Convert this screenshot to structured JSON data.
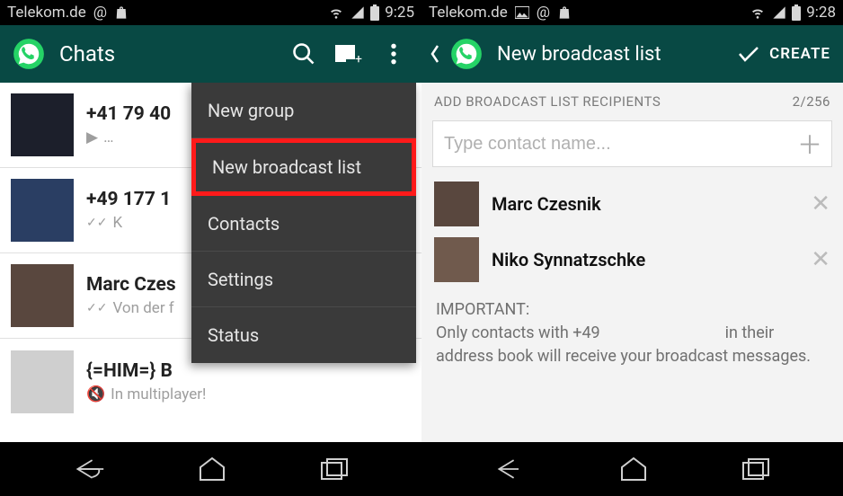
{
  "left": {
    "status": {
      "carrier": "Telekom.de",
      "time": "9:25"
    },
    "appbar": {
      "title": "Chats"
    },
    "chats": [
      {
        "name": "+41 79 40",
        "sub": "…",
        "avatar": "av-dark",
        "play": true
      },
      {
        "name": "+49 177 1",
        "sub": "K",
        "avatar": "av-blue",
        "read": true
      },
      {
        "name": "Marc Czes",
        "sub": "Von der f",
        "avatar": "av-man1",
        "read": true
      },
      {
        "name": "{=HIM=} B",
        "sub": "In multiplayer!",
        "avatar": "av-ph",
        "muted": true
      }
    ],
    "menu": [
      {
        "label": "New group"
      },
      {
        "label": "New broadcast list",
        "highlight": true
      },
      {
        "label": "Contacts"
      },
      {
        "label": "Settings"
      },
      {
        "label": "Status"
      }
    ]
  },
  "right": {
    "status": {
      "carrier": "Telekom.de",
      "time": "9:28"
    },
    "appbar": {
      "title": "New broadcast list",
      "action": "CREATE"
    },
    "section": {
      "label": "ADD BROADCAST LIST RECIPIENTS",
      "count": "2/256"
    },
    "input": {
      "placeholder": "Type contact name..."
    },
    "recipients": [
      {
        "name": "Marc Czesnik",
        "avatar": "av-man1"
      },
      {
        "name": "Niko Synnatzschke",
        "avatar": "av-man2"
      }
    ],
    "info": {
      "heading": "IMPORTANT:",
      "line1a": "Only contacts with +49",
      "line1b": "in their",
      "line2": "address book will receive your broadcast messages."
    }
  }
}
